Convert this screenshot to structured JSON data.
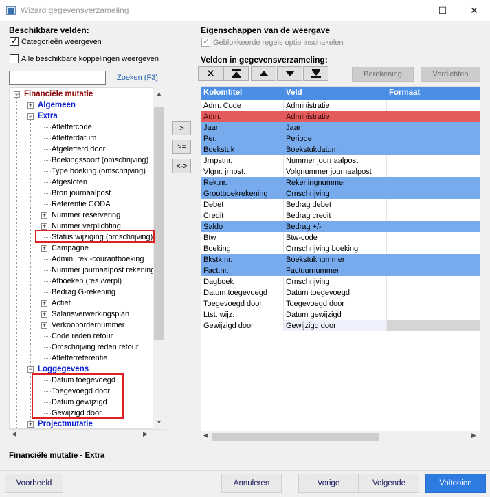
{
  "window": {
    "title": "Wizard gegevensverzameling",
    "controls": {
      "minimize": "—",
      "maximize": "☐",
      "close": "✕"
    }
  },
  "left": {
    "section_title": "Beschikbare velden:",
    "checkbox_categories": {
      "label": "Categorieën weergeven",
      "checked": true
    },
    "checkbox_all_links": {
      "label": "Alle beschikbare koppelingen weergeven",
      "checked": false
    },
    "search": {
      "value": "",
      "button": "Zoeken (F3)"
    },
    "tree": [
      {
        "label": "Financiële mutatie",
        "group": true,
        "dark": true,
        "level": 0,
        "exp": "−"
      },
      {
        "label": "Algemeen",
        "group": true,
        "level": 1,
        "exp": "+"
      },
      {
        "label": "Extra",
        "group": true,
        "level": 1,
        "exp": "−"
      },
      {
        "label": "Aflettercode",
        "level": 2
      },
      {
        "label": "Afletterdatum",
        "level": 2
      },
      {
        "label": "Afgeletterd door",
        "level": 2
      },
      {
        "label": "Boekingssoort (omschrijving)",
        "level": 2
      },
      {
        "label": "Type boeking (omschrijving)",
        "level": 2
      },
      {
        "label": "Afgesloten",
        "level": 2
      },
      {
        "label": "Bron journaalpost",
        "level": 2
      },
      {
        "label": "Referentie CODA",
        "level": 2
      },
      {
        "label": "Nummer reservering",
        "level": 2,
        "exp": "+"
      },
      {
        "label": "Nummer verplichting",
        "level": 2,
        "exp": "+"
      },
      {
        "label": "Status wijziging (omschrijving)",
        "level": 2
      },
      {
        "label": "Campagne",
        "level": 2,
        "exp": "+"
      },
      {
        "label": "Admin. rek.-courantboeking",
        "level": 2
      },
      {
        "label": "Nummer journaalpost rekening-c",
        "level": 2
      },
      {
        "label": "Afboeken (res./verpl)",
        "level": 2
      },
      {
        "label": "Bedrag G-rekening",
        "level": 2
      },
      {
        "label": "Actief",
        "level": 2,
        "exp": "+"
      },
      {
        "label": "Salarisverwerkingsplan",
        "level": 2,
        "exp": "+"
      },
      {
        "label": "Verkoopordernummer",
        "level": 2,
        "exp": "+"
      },
      {
        "label": "Code reden retour",
        "level": 2
      },
      {
        "label": "Omschrijving reden retour",
        "level": 2
      },
      {
        "label": "Afletterreferentie",
        "level": 2
      },
      {
        "label": "Loggegevens",
        "group": true,
        "level": 1,
        "exp": "−"
      },
      {
        "label": "Datum toegevoegd",
        "level": 2
      },
      {
        "label": "Toegevoegd door",
        "level": 2
      },
      {
        "label": "Datum gewijzigd",
        "level": 2
      },
      {
        "label": "Gewijzigd door",
        "level": 2
      },
      {
        "label": "Projectmutatie",
        "group": true,
        "level": 1,
        "exp": "+"
      }
    ],
    "footer_label": "Financiële mutatie - Extra"
  },
  "middle_buttons": [
    ">",
    ">=",
    "<->"
  ],
  "right": {
    "props_title": "Eigenschappen van de weergave",
    "checkbox_blocked": {
      "label": "Geblokkeerde regels optie inschakelen",
      "checked": true
    },
    "fields_title": "Velden in gegevensverzameling:",
    "toolbar": [
      {
        "name": "delete",
        "glyph": "✕"
      },
      {
        "name": "move-top",
        "glyph": "⏫"
      },
      {
        "name": "move-up",
        "glyph": "▲"
      },
      {
        "name": "move-down",
        "glyph": "▼"
      },
      {
        "name": "move-bottom",
        "glyph": "⏬"
      }
    ],
    "berekening": "Berekening",
    "verdichten": "Verdichten",
    "columns": [
      "Kolomtitel",
      "Veld",
      "Formaat"
    ],
    "rows": [
      {
        "c1": "Adm. Code",
        "c2": "Administratie",
        "c3": "",
        "hl": ""
      },
      {
        "c1": "Adm.",
        "c2": "Administratie",
        "c3": "",
        "hl": "red"
      },
      {
        "c1": "Jaar",
        "c2": "Jaar",
        "c3": "",
        "hl": "blue"
      },
      {
        "c1": "Per.",
        "c2": "Periode",
        "c3": "",
        "hl": "blue"
      },
      {
        "c1": "Boekstuk",
        "c2": "Boekstukdatum",
        "c3": "",
        "hl": "blue"
      },
      {
        "c1": "Jrnpstnr.",
        "c2": "Nummer journaalpost",
        "c3": "",
        "hl": ""
      },
      {
        "c1": "Vlgnr. jrnpst.",
        "c2": "Volgnummer journaalpost",
        "c3": "",
        "hl": ""
      },
      {
        "c1": "Rek.nr.",
        "c2": "Rekeningnummer",
        "c3": "",
        "hl": "blue"
      },
      {
        "c1": "Grootboekrekening",
        "c2": "Omschrijving",
        "c3": "",
        "hl": "blue"
      },
      {
        "c1": "Debet",
        "c2": "Bedrag debet",
        "c3": "",
        "hl": ""
      },
      {
        "c1": "Credit",
        "c2": "Bedrag credit",
        "c3": "",
        "hl": ""
      },
      {
        "c1": "Saldo",
        "c2": "Bedrag +/-",
        "c3": "",
        "hl": "blue"
      },
      {
        "c1": "Btw",
        "c2": "Btw-code",
        "c3": "",
        "hl": ""
      },
      {
        "c1": "Boeking",
        "c2": "Omschrijving boeking",
        "c3": "",
        "hl": ""
      },
      {
        "c1": "Bkstk.nr.",
        "c2": "Boekstuknummer",
        "c3": "",
        "hl": "blue"
      },
      {
        "c1": "Fact.nr.",
        "c2": "Factuurnummer",
        "c3": "",
        "hl": "blue"
      },
      {
        "c1": "Dagboek",
        "c2": "Omschrijving",
        "c3": "",
        "hl": ""
      },
      {
        "c1": "Datum toegevoegd",
        "c2": "Datum toegevoegd",
        "c3": "",
        "hl": ""
      },
      {
        "c1": "Toegevoegd door",
        "c2": "Toegevoegd door",
        "c3": "",
        "hl": ""
      },
      {
        "c1": "Ltst. wijz.",
        "c2": "Datum gewijzigd",
        "c3": "",
        "hl": ""
      },
      {
        "c1": "Gewijzigd door",
        "c2": "Gewijzigd door",
        "c3": "",
        "hl": "last"
      }
    ]
  },
  "footer": {
    "voorbeeld": "Voorbeeld",
    "annuleren": "Annuleren",
    "vorige": "Vorige",
    "volgende": "Volgende",
    "voltooien": "Voltooien"
  },
  "colors": {
    "accent": "#4a8ee6",
    "row_highlight": "#77abee",
    "row_error": "#e45b5b",
    "annotation": "#e02020",
    "primary_button": "#2f7ce0"
  }
}
